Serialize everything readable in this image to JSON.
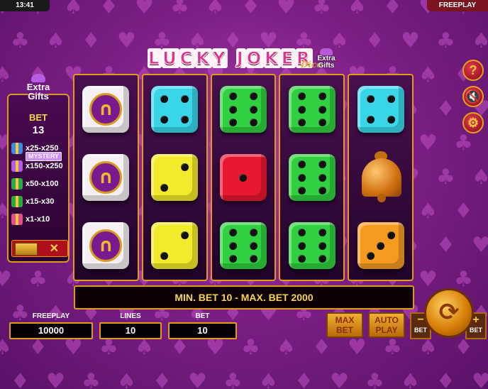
{
  "topbar": {
    "time": "13:41",
    "mode": "FREEPLAY"
  },
  "logo": {
    "letters": [
      "L",
      "U",
      "C",
      "K",
      "Y",
      " ",
      "J",
      "O",
      "K",
      "E",
      "R"
    ],
    "dice": "Dice",
    "extra": "Extra",
    "gifts": "Gifts"
  },
  "panel": {
    "extra_line1": "Extra",
    "extra_line2": "Gifts",
    "bet_label": "BET",
    "bet_value": "13",
    "mystery": "MYSTERY",
    "payouts": [
      {
        "gift": "purple-gift-icon",
        "color": "#3e8ad8",
        "value": "x25-x250"
      },
      {
        "gift": "gold-gift-icon",
        "color": "#b35ee0",
        "value": "x150-x250"
      },
      {
        "gift": "orange-gift-icon",
        "color": "#2aa84a",
        "value": "x50-x100"
      },
      {
        "gift": "green-gift-icon",
        "color": "#2ca83a",
        "value": "x15-x30"
      },
      {
        "gift": "pink-gift-icon",
        "color": "#e0508a",
        "value": "x1-x10"
      }
    ],
    "toggle_x": "✕"
  },
  "reels": [
    [
      {
        "type": "horseshoe"
      },
      {
        "type": "horseshoe"
      },
      {
        "type": "horseshoe"
      }
    ],
    [
      {
        "type": "die",
        "color": "#38d6e8",
        "pips": 4
      },
      {
        "type": "die",
        "color": "#f2ea2a",
        "pips": 2
      },
      {
        "type": "die",
        "color": "#f2ea2a",
        "pips": 2
      }
    ],
    [
      {
        "type": "die",
        "color": "#30d040",
        "pips": 6
      },
      {
        "type": "die",
        "color": "#e81830",
        "pips": 1
      },
      {
        "type": "die",
        "color": "#30d040",
        "pips": 6
      }
    ],
    [
      {
        "type": "die",
        "color": "#30d040",
        "pips": 6
      },
      {
        "type": "die",
        "color": "#30d040",
        "pips": 6
      },
      {
        "type": "die",
        "color": "#30d040",
        "pips": 6
      }
    ],
    [
      {
        "type": "die",
        "color": "#38d6e8",
        "pips": 4
      },
      {
        "type": "bell"
      },
      {
        "type": "die",
        "color": "#f59a20",
        "pips": 3
      }
    ]
  ],
  "side_buttons": [
    {
      "name": "help-icon",
      "glyph": "?"
    },
    {
      "name": "sound-off-icon",
      "glyph": "🔇"
    },
    {
      "name": "gear-icon",
      "glyph": "⚙"
    }
  ],
  "message": "MIN. BET 10 - MAX. BET 2000",
  "freeplay": {
    "label": "FREEPLAY",
    "value": "10000"
  },
  "lines": {
    "label": "LINES",
    "value": "10"
  },
  "bet": {
    "label": "BET",
    "value": "10"
  },
  "buttons": {
    "max_bet_1": "MAX",
    "max_bet_2": "BET",
    "auto_play_1": "AUTO",
    "auto_play_2": "PLAY",
    "bet_minus": "−",
    "bet_minus_label": "BET",
    "bet_plus": "+",
    "bet_plus_label": "BET",
    "spin_glyph": "⟳"
  }
}
